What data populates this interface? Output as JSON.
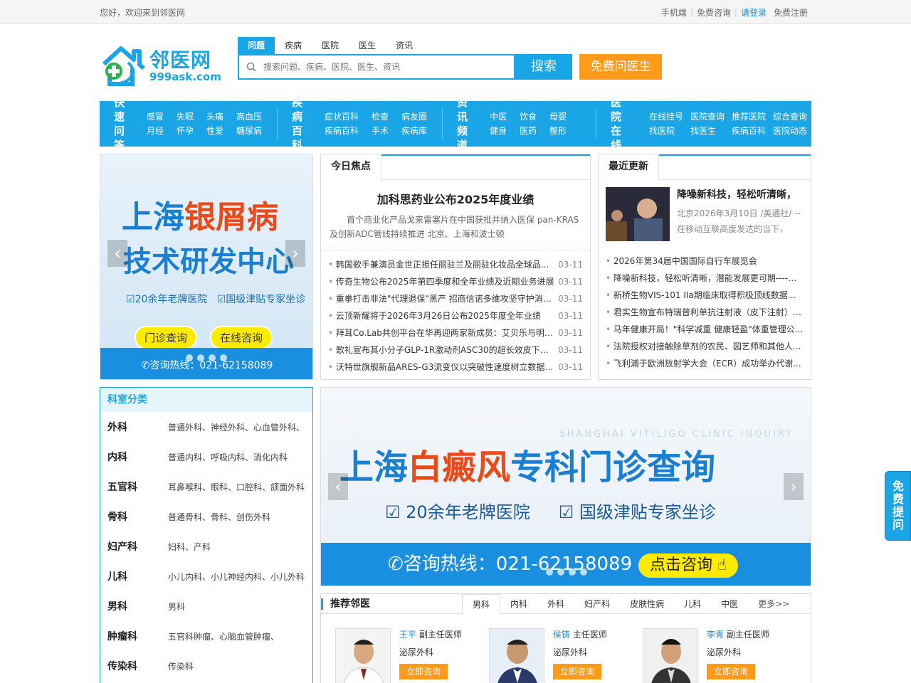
{
  "topbar": {
    "welcome": "您好，欢迎来到邻医网",
    "mobile": "手机端",
    "consult": "免费咨询",
    "login": "请登录",
    "register": "免费注册"
  },
  "logo": {
    "cn": "邻医网",
    "en": "999ask.com"
  },
  "search": {
    "tabs": [
      "问题",
      "疾病",
      "医院",
      "医生",
      "资讯"
    ],
    "placeholder": "搜索问题、疾病、医院、医生、资讯",
    "button": "搜索",
    "free_button": "免费问医生"
  },
  "nav": [
    {
      "head": "快速问答",
      "items": [
        "感冒",
        "月经",
        "失眠",
        "怀孕",
        "头痛",
        "性爱",
        "高血压",
        "糖尿病"
      ]
    },
    {
      "head": "疾病百科",
      "items": [
        "症状百科",
        "疾病百科",
        "检查",
        "手术",
        "病友圈",
        "疾病库"
      ]
    },
    {
      "head": "资讯频道",
      "items": [
        "中医",
        "健身",
        "饮食",
        "医药",
        "母婴",
        "整形"
      ]
    },
    {
      "head": "医院在线",
      "items": [
        "在线挂号",
        "找医院",
        "医院查询",
        "找医生",
        "推荐医院",
        "疾病百科",
        "综合查询",
        "医院动态"
      ]
    }
  ],
  "banner1": {
    "line1a": "上海",
    "line1b": "银屑病",
    "line2": "技术研发中心",
    "line3a": "20余年老牌医院",
    "line3b": "国级津贴专家坐诊",
    "btn1": "门诊查询",
    "btn2": "在线咨询",
    "hotline": "咨询热线：021-62158089"
  },
  "focus": {
    "header": "今日焦点",
    "title": "加科思药业公布2025年度业绩",
    "desc": "首个商业化产品戈来雷塞片在中国获批并纳入医保 pan-KRAS及创新ADC管线持续推进 北京、上海和波士顿",
    "list": [
      {
        "t": "韩国歌手兼演员金世正担任丽驻兰及丽驻化妆品全球品...",
        "d": "03-11"
      },
      {
        "t": "传奇生物公布2025年第四季度和全年业绩及近期业务进展",
        "d": "03-11"
      },
      {
        "t": "重拳打击非法\"代理退保\"黑产 招商信诺多维攻坚守护消费...",
        "d": "03-11"
      },
      {
        "t": "云顶新耀将于2026年3月26日公布2025年度全年业绩",
        "d": "03-11"
      },
      {
        "t": "拜耳Co.Lab共创平台在华再迎两家新成员：艾贝乐与明澄...",
        "d": "03-11"
      },
      {
        "t": "歌礼宣布其小分子GLP-1R激动剂ASC30的超长效皮下储库...",
        "d": "03-11"
      },
      {
        "t": "沃特世旗舰新品ARES-G3流变仪以突破性速度树立数据质...",
        "d": "03-11"
      }
    ]
  },
  "recent": {
    "header": "最近更新",
    "top_title": "降噪新科技，轻松听清晰，",
    "top_desc": "北京2026年3月10日 /美通社/ -- 在移动互联高度发达的当下，听...",
    "list": [
      "2026年第34届中国国际自行车展览会",
      "降噪新科技，轻松听清晰，潜能发展更可期----科...",
      "新桥生物VIS-101 IIa期临床取得积极顶线数据，...",
      "君实生物宣布特瑞普利单抗注射液（皮下注射）1...",
      "马年健康开局！\"科学减重 健康轻盈\"体重管理公...",
      "法院授权对接触除草剂的农民、园艺师和其他人...",
      "飞利浦于欧洲放射学大会（ECR）成功举办代谢..."
    ]
  },
  "dept": {
    "header": "科室分类",
    "rows": [
      {
        "n": "外科",
        "s": "普通外科、神经外科、心血管外科、"
      },
      {
        "n": "内科",
        "s": "普通内科、呼吸内科、消化内科"
      },
      {
        "n": "五官科",
        "s": "耳鼻喉科、眼科、口腔科、颌面外科"
      },
      {
        "n": "骨科",
        "s": "普通骨科、骨科、创伤外科"
      },
      {
        "n": "妇产科",
        "s": "妇科、产科"
      },
      {
        "n": "儿科",
        "s": "小儿内科、小儿神经内科、小儿外科"
      },
      {
        "n": "男科",
        "s": "男科"
      },
      {
        "n": "肿瘤科",
        "s": "五官科肿瘤、心脑血管肿瘤、"
      },
      {
        "n": "传染科",
        "s": "传染科"
      }
    ]
  },
  "banner2": {
    "en": "SHANGHAI VITILIGO CLINIC INQUIRY",
    "line1a": "上海",
    "line1b": "白癜风",
    "line1c": "专科门诊查询",
    "line2a": "20余年老牌医院",
    "line2b": "国级津贴专家坐诊",
    "hotline": "咨询热线：021-62158089",
    "btn": "点击咨询"
  },
  "recommend": {
    "title": "推荐邻医",
    "tabs": [
      "男科",
      "内科",
      "外科",
      "妇产科",
      "皮肤性病",
      "儿科",
      "中医"
    ],
    "more": "更多>>",
    "doctors": [
      {
        "name": "王平",
        "title": "副主任医师",
        "dept": "泌尿外科",
        "btn": "立即咨询"
      },
      {
        "name": "侯铸",
        "title": "主任医师",
        "dept": "泌尿外科",
        "btn": "立即咨询"
      },
      {
        "name": "李青",
        "title": "副主任医师",
        "dept": "泌尿外科",
        "btn": "立即咨询"
      }
    ]
  },
  "float": {
    "label": "免费提问"
  },
  "colors": {
    "primary": "#1aa5e6",
    "accent": "#ff9a1a",
    "red": "#e84a1a"
  }
}
